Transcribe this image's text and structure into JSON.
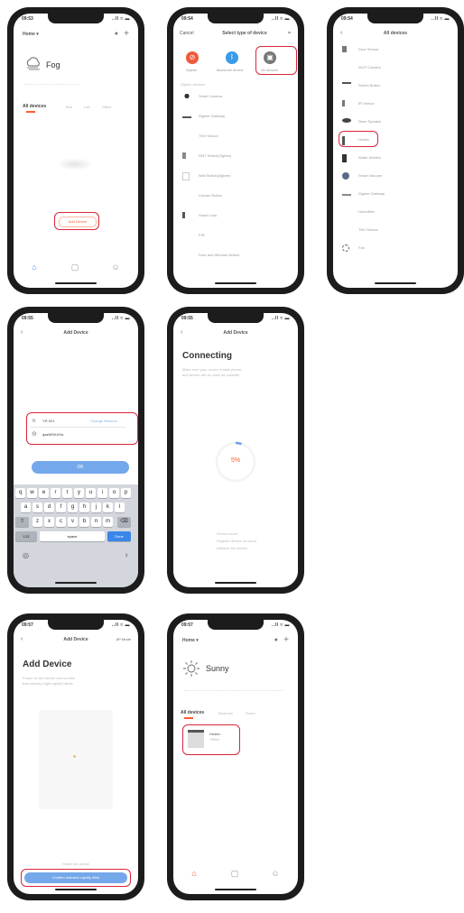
{
  "status": {
    "time_p1": "09:53",
    "time_p2": "09:54",
    "time_p3": "09:54",
    "time_p4": "09:55",
    "time_p5": "09:55",
    "time_p6": "09:57",
    "time_p7": "09:57",
    "signal": "..ll ≈ ▬"
  },
  "screen_home_fog": {
    "home_label": "Home ▾",
    "weather": "Fog",
    "tab_all": "All devices",
    "tab_2": "Bed",
    "tab_3": "Lab",
    "tab_4": "Office",
    "add_button": "Add Device"
  },
  "screen_select_type": {
    "cancel": "Cancel",
    "title": "Select type of device",
    "opt1": "Zigbee",
    "opt2": "Bluetooth device",
    "opt3": "All devices",
    "section": "Zigbee devices",
    "items": [
      "Smart Camera",
      "Zigbee Gateway",
      "TNV Sensor",
      "SMT Switch(Zigbee)",
      "Wall Switch(Zigbee)",
      "Curtain Switch",
      "Smart Lock",
      "PIR",
      "Door and Window Sensor"
    ]
  },
  "screen_all_devices": {
    "title": "All devices",
    "items": [
      "Door Sensor",
      "Wi-Fi Camera",
      "Switch Button",
      "IR Sensor",
      "Siren Speaker",
      "Heater",
      "Water Monitor",
      "Smart Vacuum",
      "Zigbee Gateway",
      "Humidifier",
      "TNV Sensor",
      "Fan"
    ]
  },
  "screen_wifi": {
    "title": "Add Device",
    "ssid": "YR-501",
    "change": "Change Network",
    "password": "qazWSX4%z",
    "ok": "OK",
    "row1": [
      "q",
      "w",
      "e",
      "r",
      "t",
      "y",
      "u",
      "i",
      "o",
      "p"
    ],
    "row2": [
      "a",
      "s",
      "d",
      "f",
      "g",
      "h",
      "j",
      "k",
      "l"
    ],
    "row3": [
      "z",
      "x",
      "c",
      "v",
      "b",
      "n",
      "m"
    ],
    "shift": "⇧",
    "backspace": "⌫",
    "numbers": "123",
    "space": "space",
    "done": "Done",
    "globe": "◎",
    "mic": "♀"
  },
  "screen_connecting": {
    "title": "Add Device",
    "heading": "Connecting",
    "desc1": "Make sure your router, mobile phone,",
    "desc2": "and device are as close as possible",
    "percent": "5%",
    "step1": "Device found",
    "step2": "Register device on cloud",
    "step3": "Initialize the device"
  },
  "screen_add_device": {
    "title": "Add Device",
    "right": "AP Mode",
    "heading": "Add Device",
    "desc1": "Power on the device and confirm",
    "desc2": "that indicator light rapidly blinks",
    "hint": "Reset the device",
    "confirm": "Confirm indicator rapidly blink"
  },
  "screen_home_sunny": {
    "home_label": "Home ▾",
    "weather": "Sunny",
    "tab_all": "All devices",
    "tab_2": "Bedroom",
    "tab_3": "Room",
    "device_name": "Heater",
    "device_status": "Offline"
  },
  "tabs": {
    "home": "Home",
    "scene": "Scene",
    "me": "Me"
  },
  "colors": {
    "highlight": "#d8263b",
    "accent": "#ff5a2d",
    "blue": "#4a90e2"
  }
}
